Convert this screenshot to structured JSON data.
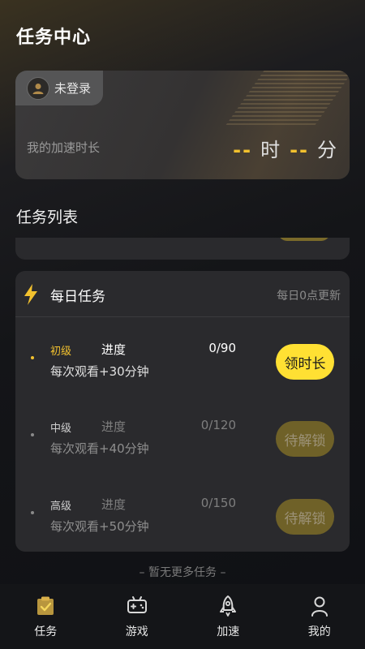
{
  "header": {
    "title": "任务中心"
  },
  "speed_card": {
    "login_text": "未登录",
    "duration_label": "我的加速时长",
    "hours_value": "--",
    "hours_unit": "时",
    "minutes_value": "--",
    "minutes_unit": "分"
  },
  "task_list": {
    "title": "任务列表"
  },
  "daily": {
    "title": "每日任务",
    "refresh_note": "每日0点更新",
    "tasks": [
      {
        "level": "初级",
        "progress_label": "进度",
        "progress": "0/90",
        "desc": "每次观看+30分钟",
        "button": "领时长",
        "state": "active"
      },
      {
        "level": "中级",
        "progress_label": "进度",
        "progress": "0/120",
        "desc": "每次观看+40分钟",
        "button": "待解锁",
        "state": "locked"
      },
      {
        "level": "高级",
        "progress_label": "进度",
        "progress": "0/150",
        "desc": "每次观看+50分钟",
        "button": "待解锁",
        "state": "locked"
      }
    ]
  },
  "footer_note": "– 暂无更多任务 –",
  "nav": {
    "items": [
      {
        "label": "任务",
        "icon": "task-clipboard-icon"
      },
      {
        "label": "游戏",
        "icon": "gamepad-icon"
      },
      {
        "label": "加速",
        "icon": "rocket-icon"
      },
      {
        "label": "我的",
        "icon": "user-icon"
      }
    ]
  },
  "colors": {
    "accent": "#f2c12e",
    "button_active": "#ffe033",
    "button_locked": "#6f6128"
  }
}
